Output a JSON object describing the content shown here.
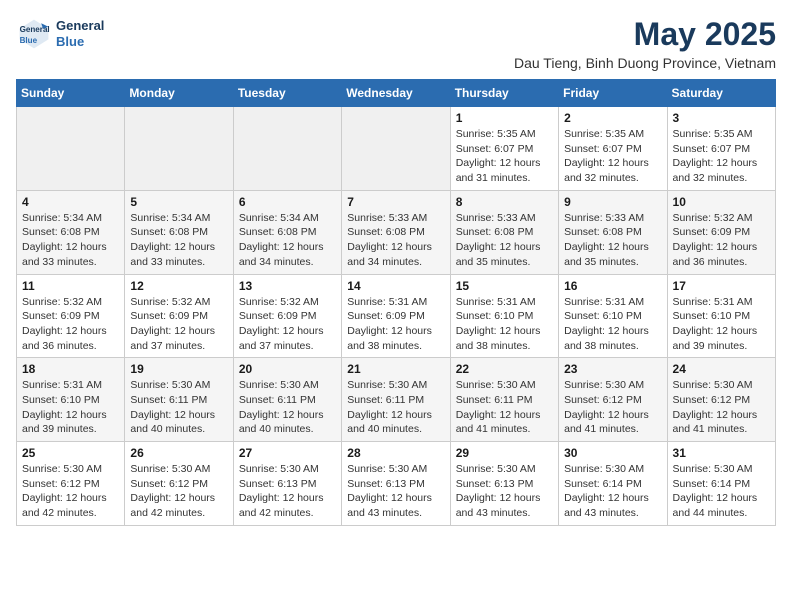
{
  "logo": {
    "line1": "General",
    "line2": "Blue"
  },
  "title": "May 2025",
  "subtitle": "Dau Tieng, Binh Duong Province, Vietnam",
  "weekdays": [
    "Sunday",
    "Monday",
    "Tuesday",
    "Wednesday",
    "Thursday",
    "Friday",
    "Saturday"
  ],
  "weeks": [
    [
      {
        "day": "",
        "info": ""
      },
      {
        "day": "",
        "info": ""
      },
      {
        "day": "",
        "info": ""
      },
      {
        "day": "",
        "info": ""
      },
      {
        "day": "1",
        "info": "Sunrise: 5:35 AM\nSunset: 6:07 PM\nDaylight: 12 hours\nand 31 minutes."
      },
      {
        "day": "2",
        "info": "Sunrise: 5:35 AM\nSunset: 6:07 PM\nDaylight: 12 hours\nand 32 minutes."
      },
      {
        "day": "3",
        "info": "Sunrise: 5:35 AM\nSunset: 6:07 PM\nDaylight: 12 hours\nand 32 minutes."
      }
    ],
    [
      {
        "day": "4",
        "info": "Sunrise: 5:34 AM\nSunset: 6:08 PM\nDaylight: 12 hours\nand 33 minutes."
      },
      {
        "day": "5",
        "info": "Sunrise: 5:34 AM\nSunset: 6:08 PM\nDaylight: 12 hours\nand 33 minutes."
      },
      {
        "day": "6",
        "info": "Sunrise: 5:34 AM\nSunset: 6:08 PM\nDaylight: 12 hours\nand 34 minutes."
      },
      {
        "day": "7",
        "info": "Sunrise: 5:33 AM\nSunset: 6:08 PM\nDaylight: 12 hours\nand 34 minutes."
      },
      {
        "day": "8",
        "info": "Sunrise: 5:33 AM\nSunset: 6:08 PM\nDaylight: 12 hours\nand 35 minutes."
      },
      {
        "day": "9",
        "info": "Sunrise: 5:33 AM\nSunset: 6:08 PM\nDaylight: 12 hours\nand 35 minutes."
      },
      {
        "day": "10",
        "info": "Sunrise: 5:32 AM\nSunset: 6:09 PM\nDaylight: 12 hours\nand 36 minutes."
      }
    ],
    [
      {
        "day": "11",
        "info": "Sunrise: 5:32 AM\nSunset: 6:09 PM\nDaylight: 12 hours\nand 36 minutes."
      },
      {
        "day": "12",
        "info": "Sunrise: 5:32 AM\nSunset: 6:09 PM\nDaylight: 12 hours\nand 37 minutes."
      },
      {
        "day": "13",
        "info": "Sunrise: 5:32 AM\nSunset: 6:09 PM\nDaylight: 12 hours\nand 37 minutes."
      },
      {
        "day": "14",
        "info": "Sunrise: 5:31 AM\nSunset: 6:09 PM\nDaylight: 12 hours\nand 38 minutes."
      },
      {
        "day": "15",
        "info": "Sunrise: 5:31 AM\nSunset: 6:10 PM\nDaylight: 12 hours\nand 38 minutes."
      },
      {
        "day": "16",
        "info": "Sunrise: 5:31 AM\nSunset: 6:10 PM\nDaylight: 12 hours\nand 38 minutes."
      },
      {
        "day": "17",
        "info": "Sunrise: 5:31 AM\nSunset: 6:10 PM\nDaylight: 12 hours\nand 39 minutes."
      }
    ],
    [
      {
        "day": "18",
        "info": "Sunrise: 5:31 AM\nSunset: 6:10 PM\nDaylight: 12 hours\nand 39 minutes."
      },
      {
        "day": "19",
        "info": "Sunrise: 5:30 AM\nSunset: 6:11 PM\nDaylight: 12 hours\nand 40 minutes."
      },
      {
        "day": "20",
        "info": "Sunrise: 5:30 AM\nSunset: 6:11 PM\nDaylight: 12 hours\nand 40 minutes."
      },
      {
        "day": "21",
        "info": "Sunrise: 5:30 AM\nSunset: 6:11 PM\nDaylight: 12 hours\nand 40 minutes."
      },
      {
        "day": "22",
        "info": "Sunrise: 5:30 AM\nSunset: 6:11 PM\nDaylight: 12 hours\nand 41 minutes."
      },
      {
        "day": "23",
        "info": "Sunrise: 5:30 AM\nSunset: 6:12 PM\nDaylight: 12 hours\nand 41 minutes."
      },
      {
        "day": "24",
        "info": "Sunrise: 5:30 AM\nSunset: 6:12 PM\nDaylight: 12 hours\nand 41 minutes."
      }
    ],
    [
      {
        "day": "25",
        "info": "Sunrise: 5:30 AM\nSunset: 6:12 PM\nDaylight: 12 hours\nand 42 minutes."
      },
      {
        "day": "26",
        "info": "Sunrise: 5:30 AM\nSunset: 6:12 PM\nDaylight: 12 hours\nand 42 minutes."
      },
      {
        "day": "27",
        "info": "Sunrise: 5:30 AM\nSunset: 6:13 PM\nDaylight: 12 hours\nand 42 minutes."
      },
      {
        "day": "28",
        "info": "Sunrise: 5:30 AM\nSunset: 6:13 PM\nDaylight: 12 hours\nand 43 minutes."
      },
      {
        "day": "29",
        "info": "Sunrise: 5:30 AM\nSunset: 6:13 PM\nDaylight: 12 hours\nand 43 minutes."
      },
      {
        "day": "30",
        "info": "Sunrise: 5:30 AM\nSunset: 6:14 PM\nDaylight: 12 hours\nand 43 minutes."
      },
      {
        "day": "31",
        "info": "Sunrise: 5:30 AM\nSunset: 6:14 PM\nDaylight: 12 hours\nand 44 minutes."
      }
    ]
  ]
}
